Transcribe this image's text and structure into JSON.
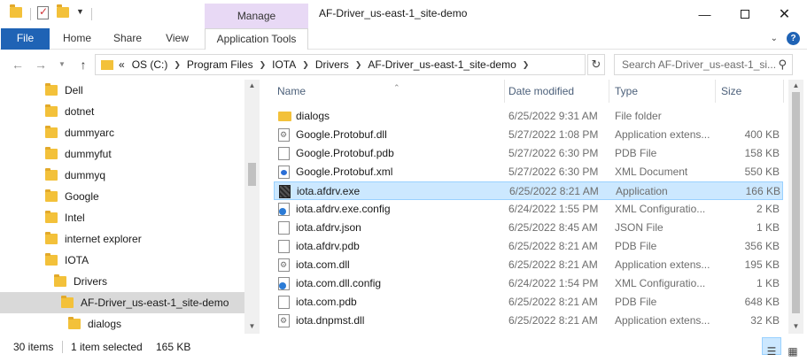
{
  "title_bar": {
    "window_title": "AF-Driver_us-east-1_site-demo",
    "manage_label": "Manage",
    "minimize_icon": "minimize-icon",
    "maximize_icon": "maximize-icon",
    "close_icon": "close-icon"
  },
  "ribbon": {
    "tabs": [
      {
        "label": "File"
      },
      {
        "label": "Home"
      },
      {
        "label": "Share"
      },
      {
        "label": "View"
      },
      {
        "label": "Application Tools"
      }
    ]
  },
  "address": {
    "overflow": "«",
    "crumbs": [
      "OS (C:)",
      "Program Files",
      "IOTA",
      "Drivers",
      "AF-Driver_us-east-1_site-demo"
    ],
    "search_placeholder": "Search AF-Driver_us-east-1_si..."
  },
  "tree": {
    "items": [
      {
        "label": "Dell",
        "indent": 0
      },
      {
        "label": "dotnet",
        "indent": 0
      },
      {
        "label": "dummyarc",
        "indent": 0
      },
      {
        "label": "dummyfut",
        "indent": 0
      },
      {
        "label": "dummyq",
        "indent": 0
      },
      {
        "label": "Google",
        "indent": 0
      },
      {
        "label": "Intel",
        "indent": 0
      },
      {
        "label": "internet explorer",
        "indent": 0
      },
      {
        "label": "IOTA",
        "indent": 0
      },
      {
        "label": "Drivers",
        "indent": 1
      },
      {
        "label": "AF-Driver_us-east-1_site-demo",
        "indent": 2,
        "selected": true
      },
      {
        "label": "dialogs",
        "indent": 3
      }
    ]
  },
  "columns": {
    "name": "Name",
    "date": "Date modified",
    "type": "Type",
    "size": "Size"
  },
  "files": [
    {
      "name": "dialogs",
      "date": "6/25/2022 9:31 AM",
      "type": "File folder",
      "size": "",
      "icon": "folder"
    },
    {
      "name": "Google.Protobuf.dll",
      "date": "5/27/2022 1:08 PM",
      "type": "Application extens...",
      "size": "400 KB",
      "icon": "dll"
    },
    {
      "name": "Google.Protobuf.pdb",
      "date": "5/27/2022 6:30 PM",
      "type": "PDB File",
      "size": "158 KB",
      "icon": "doc"
    },
    {
      "name": "Google.Protobuf.xml",
      "date": "5/27/2022 6:30 PM",
      "type": "XML Document",
      "size": "550 KB",
      "icon": "xml"
    },
    {
      "name": "iota.afdrv.exe",
      "date": "6/25/2022 8:21 AM",
      "type": "Application",
      "size": "166 KB",
      "icon": "exe",
      "selected": true
    },
    {
      "name": "iota.afdrv.exe.config",
      "date": "6/24/2022 1:55 PM",
      "type": "XML Configuratio...",
      "size": "2 KB",
      "icon": "cfg"
    },
    {
      "name": "iota.afdrv.json",
      "date": "6/25/2022 8:45 AM",
      "type": "JSON File",
      "size": "1 KB",
      "icon": "doc"
    },
    {
      "name": "iota.afdrv.pdb",
      "date": "6/25/2022 8:21 AM",
      "type": "PDB File",
      "size": "356 KB",
      "icon": "doc"
    },
    {
      "name": "iota.com.dll",
      "date": "6/25/2022 8:21 AM",
      "type": "Application extens...",
      "size": "195 KB",
      "icon": "dll"
    },
    {
      "name": "iota.com.dll.config",
      "date": "6/24/2022 1:54 PM",
      "type": "XML Configuratio...",
      "size": "1 KB",
      "icon": "cfg"
    },
    {
      "name": "iota.com.pdb",
      "date": "6/25/2022 8:21 AM",
      "type": "PDB File",
      "size": "648 KB",
      "icon": "doc"
    },
    {
      "name": "iota.dnpmst.dll",
      "date": "6/25/2022 8:21 AM",
      "type": "Application extens...",
      "size": "32 KB",
      "icon": "dll"
    }
  ],
  "status": {
    "item_count": "30 items",
    "selection": "1 item selected",
    "selection_size": "165 KB"
  },
  "colors": {
    "accent": "#1f63b5",
    "selection_bg": "#cce8ff",
    "selection_border": "#99d1ff",
    "manage_bg": "#e8d9f5",
    "folder": "#f3c13a"
  }
}
